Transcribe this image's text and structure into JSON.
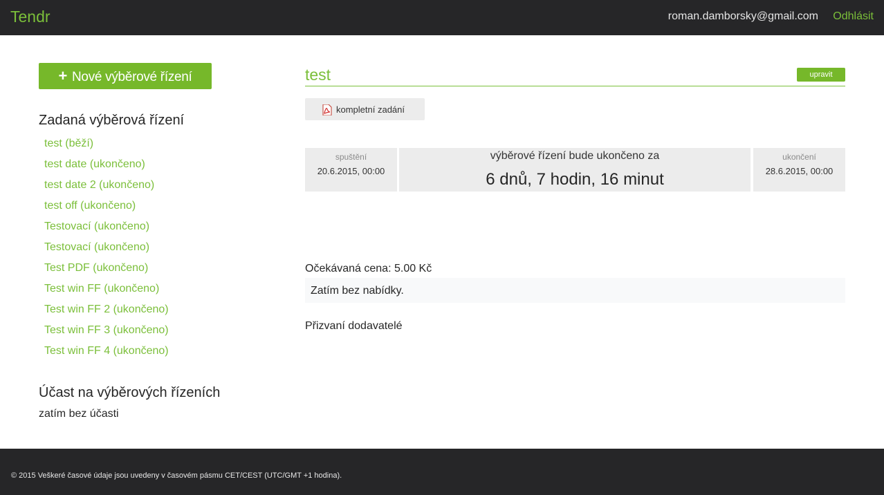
{
  "header": {
    "brand": "Tendr",
    "user_email": "roman.damborsky@gmail.com",
    "logout_label": "Odhlásit"
  },
  "sidebar": {
    "new_button_label": "Nové výběrové řízení",
    "assigned_title": "Zadaná výběrová řízení",
    "tenders": [
      "test (běží)",
      "test date (ukončeno)",
      "test date 2 (ukončeno)",
      "test off (ukončeno)",
      "Testovací (ukončeno)",
      "Testovací (ukončeno)",
      "Test PDF (ukončeno)",
      "Test win FF (ukončeno)",
      "Test win FF 2 (ukončeno)",
      "Test win FF 3 (ukončeno)",
      "Test win FF 4 (ukončeno)"
    ],
    "participation_title": "Účast na výběrových řízeních",
    "participation_empty": "zatím bez účasti"
  },
  "main": {
    "title": "test",
    "edit_label": "upravit",
    "document_label": "kompletní zadání",
    "start": {
      "label": "spuštění",
      "date": "20.6.2015, 00:00"
    },
    "countdown": {
      "label": "výběrové řízení bude ukončeno za",
      "value": "6 dnů, 7 hodin, 16 minut"
    },
    "end": {
      "label": "ukončení",
      "date": "28.6.2015, 00:00"
    },
    "expected_price": "Očekávaná cena: 5.00 Kč",
    "offers_empty": "Zatím bez nabídky.",
    "suppliers_title": "Přizvaní dodavatelé"
  },
  "footer": {
    "text": "© 2015 Veškeré časové údaje jsou uvedeny v časovém pásmu CET/CEST (UTC/GMT +1 hodina)."
  },
  "colors": {
    "accent": "#76b82a",
    "link": "#7bbf3a",
    "navbar": "#262628"
  },
  "icons": {
    "new_button": "plus-icon",
    "document": "pdf-icon"
  }
}
